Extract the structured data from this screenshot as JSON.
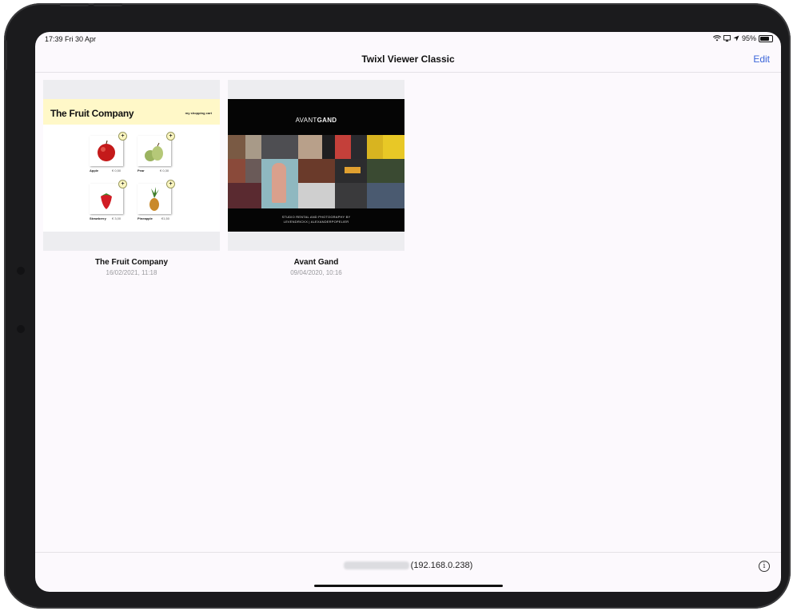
{
  "status": {
    "time": "17:39  Fri 30 Apr",
    "battery": "95%",
    "battery_level": 0.95
  },
  "nav": {
    "title": "Twixl Viewer Classic",
    "edit_label": "Edit"
  },
  "publications": [
    {
      "title": "The Fruit Company",
      "date": "16/02/2021, 11:18",
      "cover": {
        "brand": "The Fruit Company",
        "cart": "my shopping cart",
        "products": [
          {
            "name": "Apple",
            "price": "€ 0,50"
          },
          {
            "name": "Pear",
            "price": "€ 0,30"
          },
          {
            "name": "Strawberry",
            "price": "€ 3,00"
          },
          {
            "name": "Pineapple",
            "price": "€1,50"
          }
        ],
        "plus": "+"
      }
    },
    {
      "title": "Avant Gand",
      "date": "09/04/2020, 10:16",
      "cover": {
        "logo_light": "AVANT",
        "logo_bold": "GAND",
        "caption_line1": "STUDIO RENTAL AND PHOTOGRAPHY BY",
        "caption_line2": "LEVENDRICKX | ALEXANDERPOPELIER"
      }
    }
  ],
  "footer": {
    "server": "(192.168.0.238)",
    "info_icon": "i"
  },
  "colors": {
    "accent": "#3b65d9",
    "screen_bg": "#fcf9fd",
    "bezel": "#1b1b1d"
  }
}
